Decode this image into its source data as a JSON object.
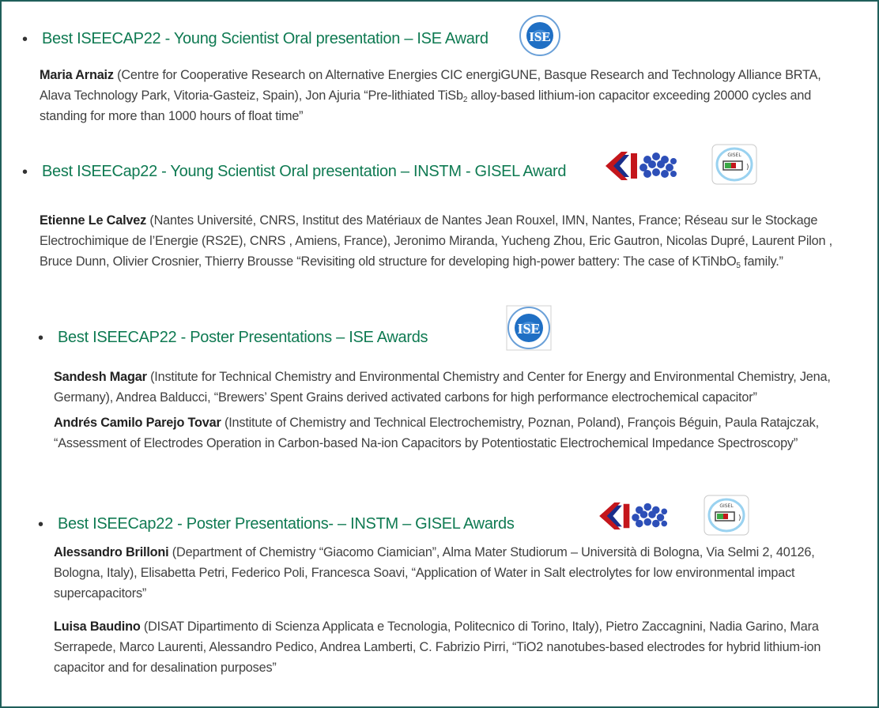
{
  "awards": [
    {
      "title": "Best ISEECAP22 - Young Scientist Oral presentation – ISE Award",
      "entries": [
        {
          "name": "Maria Arnaiz",
          "pre": " (Centre for Cooperative Research on Alternative Energies CIC energiGUNE, Basque Research and Technology Alliance BRTA, Alava Technology Park, Vitoria-Gasteiz, Spain), Jon Ajuria “Pre-lithiated TiSb",
          "sub": "2",
          "post": " alloy-based lithium-ion capacitor exceeding 20000 cycles and standing for more than 1000 hours of float time”"
        }
      ]
    },
    {
      "title": "Best ISEECap22 -  Young Scientist Oral presentation – INSTM - GISEL Award",
      "entries": [
        {
          "name": "Etienne Le Calvez",
          "pre": " (Nantes Université, CNRS, Institut des Matériaux de Nantes Jean Rouxel, IMN, Nantes, France; Réseau sur le Stockage Electrochimique de l’Energie (RS2E), CNRS , Amiens, France), Jeronimo Miranda, Yucheng Zhou, Eric Gautron, Nicolas Dupré, Laurent Pilon , Bruce Dunn, Olivier Crosnier, Thierry Brousse “Revisiting old structure for developing high-power battery: The case of KTiNbO",
          "sub": "5",
          "post": " family.”"
        }
      ]
    },
    {
      "title": "Best ISEECAP22 - Poster Presentations – ISE Awards",
      "entries": [
        {
          "name": "Sandesh Magar",
          "pre": " (Institute for Technical Chemistry and Environmental Chemistry and Center for Energy and Environmental Chemistry, Jena, Germany), Andrea Balducci, “Brewers’ Spent Grains derived activated carbons for high performance electrochemical capacitor”"
        },
        {
          "name": "Andrés Camilo Parejo Tovar",
          "pre": " (Institute of Chemistry and Technical Electrochemistry, Poznan, Poland), François Béguin, Paula Ratajczak, “Assessment of Electrodes Operation in Carbon-based Na-ion Capacitors by Potentiostatic Electrochemical Impedance Spectroscopy”"
        }
      ]
    },
    {
      "title": "Best ISEECap22 -  Poster Presentations- – INSTM – GISEL Awards",
      "entries": [
        {
          "name": "Alessandro Brilloni",
          "pre": " (Department of Chemistry “Giacomo Ciamician”, Alma Mater Studiorum – Università di Bologna, Via Selmi 2, 40126, Bologna, Italy), Elisabetta Petri, Federico Poli, Francesca Soavi, “Application of Water in Salt electrolytes for low environmental impact supercapacitors”"
        },
        {
          "name": "Luisa Baudino",
          "pre": " (DISAT Dipartimento di Scienza Applicata e Tecnologia, Politecnico di Torino, Italy), Pietro Zaccagnini, Nadia Garino, Mara Serrapede, Marco Laurenti, Alessandro Pedico, Andrea Lamberti, C. Fabrizio Pirri, “TiO2 nanotubes-based electrodes for hybrid lithium-ion capacitor and for desalination purposes”"
        }
      ]
    }
  ],
  "logos": {
    "ise": {
      "text": "ISE",
      "ring_text": "INTERNATIONAL SOCIETY OF ELECTROCHEMISTRY",
      "color": "#1f6fc4"
    },
    "instm": {
      "text": "INSTM",
      "color": "#c4161c"
    },
    "gisel": {
      "text": "GISEL",
      "color": "#3aa845"
    }
  },
  "bullet": "•"
}
